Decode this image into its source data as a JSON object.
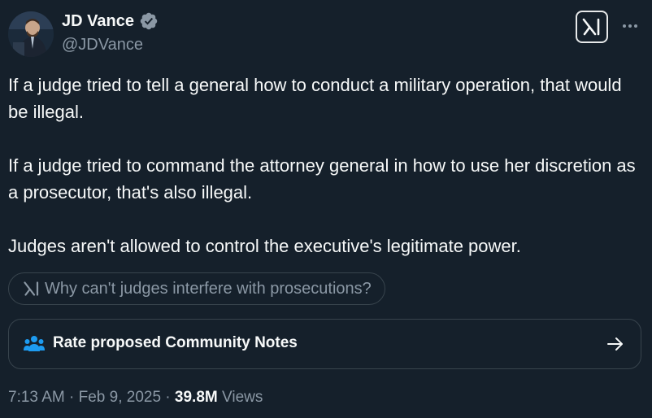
{
  "author": {
    "name": "JD Vance",
    "handle": "@JDVance",
    "verified": true
  },
  "tweet": {
    "paragraphs": [
      "If a judge tried to tell a general how to conduct a military operation, that would be illegal.",
      "If a judge tried to command the attorney general in how to use her discretion as a prosecutor, that's also illegal.",
      "Judges aren't allowed to control the executive's legitimate power."
    ]
  },
  "grok_prompt": {
    "icon": "grok-icon",
    "label": "Why can't judges interfere with prosecutions?"
  },
  "community_notes": {
    "icon": "people-icon",
    "label": "Rate proposed Community Notes",
    "arrow_icon": "arrow-right-icon"
  },
  "meta": {
    "time": "7:13 AM",
    "separator": " · ",
    "date": "Feb 9, 2025",
    "views_count": "39.8M",
    "views_label": "Views"
  },
  "colors": {
    "background": "#15202b",
    "text": "#f7f9f9",
    "secondary_text": "#8b98a5",
    "verified_badge": "#8b98a5",
    "notes_icon": "#1d9bf0",
    "border": "#38444d"
  }
}
